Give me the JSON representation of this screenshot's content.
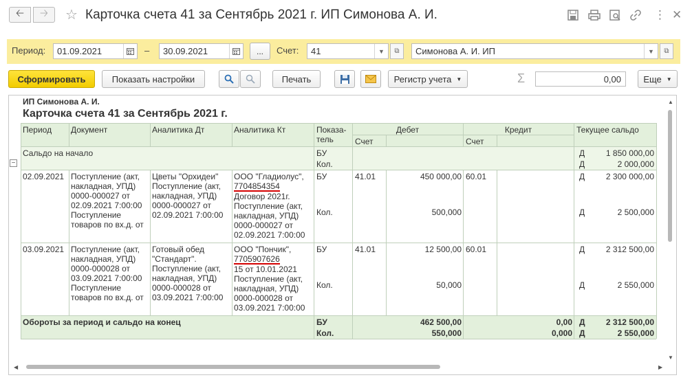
{
  "window": {
    "title": "Карточка счета 41 за Сентябрь 2021 г. ИП Симонова А. И.",
    "back_icon": "arrow-left-icon",
    "forward_icon": "arrow-right-icon",
    "star_icon": "star-icon",
    "more_glyph": "⋮",
    "close_glyph": "✕"
  },
  "params": {
    "period_label": "Период:",
    "date_from": "01.09.2021",
    "dash": "–",
    "date_to": "30.09.2021",
    "dots": "...",
    "account_label": "Счет:",
    "account": "41",
    "organization": "Симонова А. И. ИП"
  },
  "toolbar": {
    "generate": "Сформировать",
    "show_settings": "Показать настройки",
    "print": "Печать",
    "register": "Регистр учета",
    "sum_value": "0,00",
    "more": "Еще"
  },
  "report": {
    "org": "ИП Симонова А. И.",
    "title": "Карточка счета 41 за Сентябрь 2021 г.",
    "headers": {
      "period": "Период",
      "document": "Документ",
      "an_dt": "Аналитика Дт",
      "an_kt": "Аналитика Кт",
      "indicator": "Показа-\nтель",
      "debit": "Дебет",
      "credit": "Кредит",
      "balance": "Текущее сальдо",
      "account": "Счет"
    },
    "opening": {
      "label": "Сальдо на начало",
      "ind1": "БУ",
      "ind2": "Кол.",
      "dk1": "Д",
      "dk2": "Д",
      "bal1": "1 850 000,00",
      "bal2": "2 000,000"
    },
    "rows": [
      {
        "date": "02.09.2021",
        "doc": "Поступление (акт, накладная, УПД) 0000-000027 от 02.09.2021 7:00:00 Поступление товаров по вх.д.  от",
        "an_dt": "Цветы \"Орхидеи\" Поступление (акт, накладная, УПД) 0000-000027 от 02.09.2021 7:00:00",
        "an_kt_a": "ООО \"Гладиолус\",",
        "an_kt_inn": "7704854354",
        "an_kt_b": "Договор 2021г. Поступление (акт, накладная, УПД) 0000-000027 от 02.09.2021 7:00:00",
        "ind1": "БУ",
        "ind2": "Кол.",
        "dt_acc": "41.01",
        "dt_sum": "450 000,00",
        "dt_qty": "500,000",
        "kt_acc": "60.01",
        "dk1": "Д",
        "dk2": "Д",
        "bal1": "2 300 000,00",
        "bal2": "2 500,000"
      },
      {
        "date": "03.09.2021",
        "doc": "Поступление (акт, накладная, УПД) 0000-000028 от 03.09.2021 7:00:00 Поступление товаров по вх.д.  от",
        "an_dt": "Готовый обед \"Стандарт\". Поступление (акт, накладная, УПД) 0000-000028 от 03.09.2021 7:00:00",
        "an_kt_a": "ООО \"Пончик\",",
        "an_kt_inn": "7705907626",
        "an_kt_b": "15 от 10.01.2021 Поступление (акт, накладная, УПД) 0000-000028 от 03.09.2021 7:00:00",
        "ind1": "БУ",
        "ind2": "Кол.",
        "dt_acc": "41.01",
        "dt_sum": "12 500,00",
        "dt_qty": "50,000",
        "kt_acc": "60.01",
        "dk1": "Д",
        "dk2": "Д",
        "bal1": "2 312 500,00",
        "bal2": "2 550,000"
      }
    ],
    "totals": {
      "label": "Обороты за период и сальдо на конец",
      "ind1": "БУ",
      "ind2": "Кол.",
      "dt_sum": "462 500,00",
      "dt_qty": "550,000",
      "kt_sum": "0,00",
      "kt_qty": "0,000",
      "dk1": "Д",
      "dk2": "Д",
      "bal1": "2 312 500,00",
      "bal2": "2 550,000"
    }
  },
  "colors": {
    "accent_yellow": "#f2cc00",
    "params_bg": "#fbed9e",
    "header_green": "#e3f0dc",
    "underline_red": "#d40000"
  }
}
